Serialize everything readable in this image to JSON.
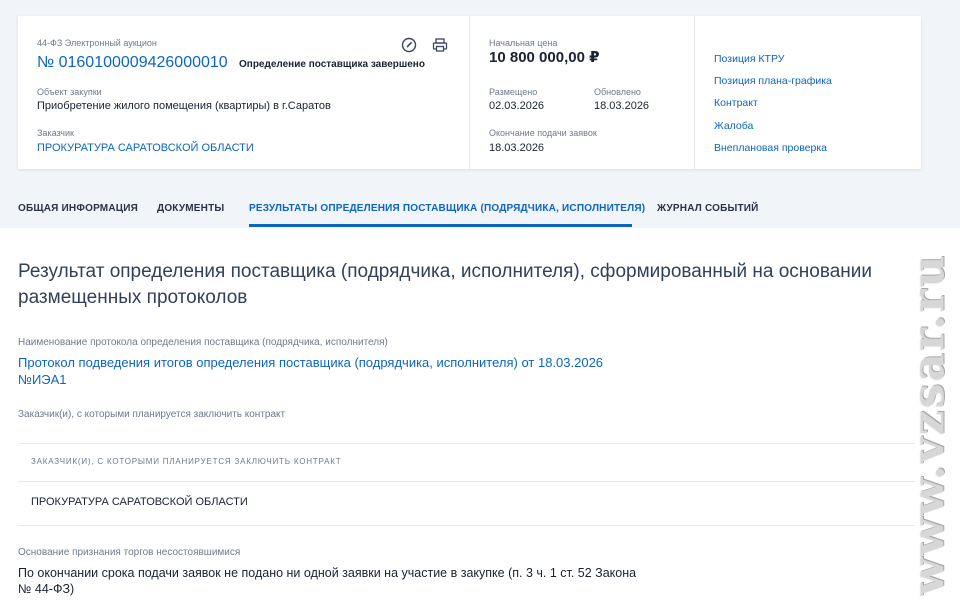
{
  "notice": {
    "law_type": "44-ФЗ Электронный аукцион",
    "number": "№ 0160100009426000010",
    "status": "Определение поставщика завершено",
    "object_label": "Объект закупки",
    "object_value": "Приобретение жилого помещения (квартиры) в г.Саратов",
    "customer_label": "Заказчик",
    "customer_value": "ПРОКУРАТУРА САРАТОВСКОЙ ОБЛАСТИ",
    "icons": [
      "search-doc-icon",
      "print-icon"
    ]
  },
  "price": {
    "label": "Начальная цена",
    "value": "10 800 000,00 ₽",
    "placed_label": "Размещено",
    "placed_value": "02.03.2026",
    "updated_label": "Обновлено",
    "updated_value": "18.03.2026",
    "deadline_label": "Окончание подачи заявок",
    "deadline_value": "18.03.2026"
  },
  "links": [
    "Позиция КТРУ",
    "Позиция плана-графика",
    "Контракт",
    "Жалоба",
    "Внеплановая проверка"
  ],
  "tabs": [
    {
      "label": "ОБЩАЯ ИНФОРМАЦИЯ",
      "active": false
    },
    {
      "label": "ДОКУМЕНТЫ",
      "active": false
    },
    {
      "label": "РЕЗУЛЬТАТЫ ОПРЕДЕЛЕНИЯ ПОСТАВЩИКА (ПОДРЯДЧИКА, ИСПОЛНИТЕЛЯ)",
      "active": true
    },
    {
      "label": "ЖУРНАЛ СОБЫТИЙ",
      "active": false
    }
  ],
  "result": {
    "title": "Результат определения поставщика (подрядчика, исполнителя), сформированный на основании размещенных протоколов",
    "protocol_label": "Наименование протокола определения поставщика (подрядчика, исполнителя)",
    "protocol_link_line1": "Протокол подведения итогов определения поставщика (подрядчика, исполнителя) от 18.03.2026",
    "protocol_link_line2": "№ИЭА1",
    "customers_label": "Заказчик(и), с которыми планируется заключить контракт",
    "table_header": "ЗАКАЗЧИК(И), С КОТОРЫМИ ПЛАНИРУЕТСЯ ЗАКЛЮЧИТЬ КОНТРАКТ",
    "table_rows": [
      "ПРОКУРАТУРА САРАТОВСКОЙ ОБЛАСТИ"
    ],
    "failure_label": "Основание признания торгов несостоявшимися",
    "failure_value": "По окончании срока подачи заявок не подано ни одной заявки на участие в закупке (п. 3 ч. 1 ст. 52 Закона № 44-ФЗ)"
  },
  "watermark": "www.vzsar.ru",
  "colors": {
    "accent": "#0d65c3",
    "page_background": "#f1f4f9",
    "text": "#1a2233",
    "muted": "#6f7a8c"
  }
}
